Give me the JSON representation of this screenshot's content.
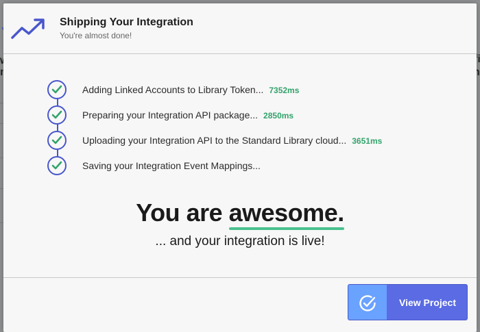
{
  "header": {
    "title": "Shipping Your Integration",
    "subtitle": "You're almost done!",
    "icon": "trending-up-icon"
  },
  "steps": [
    {
      "label": "Adding Linked Accounts to Library Token...",
      "time": "7352ms",
      "status": "complete"
    },
    {
      "label": "Preparing your Integration API package...",
      "time": "2850ms",
      "status": "complete"
    },
    {
      "label": "Uploading your Integration API to the Standard Library cloud...",
      "time": "3651ms",
      "status": "complete"
    },
    {
      "label": "Saving your Integration Event Mappings...",
      "time": "",
      "status": "complete"
    }
  ],
  "celebration": {
    "prefix": "You are ",
    "highlight": "awesome.",
    "subline": "... and your integration is live!"
  },
  "footer": {
    "view_project_label": "View Project",
    "view_project_icon": "check-circle-icon"
  },
  "colors": {
    "accent": "#4957cc",
    "success": "#33a36b",
    "underline": "#49c18f",
    "button": "#5a6be4",
    "button_icon_bg": "#6aa2ff"
  },
  "backdrop": {
    "fragment_left_1": "Y",
    "fragment_left_2": "w",
    "fragment_left_3": "n",
    "fragment_right_1": "fi",
    "fragment_right_2": "w",
    "fragment_right_3": "n"
  }
}
